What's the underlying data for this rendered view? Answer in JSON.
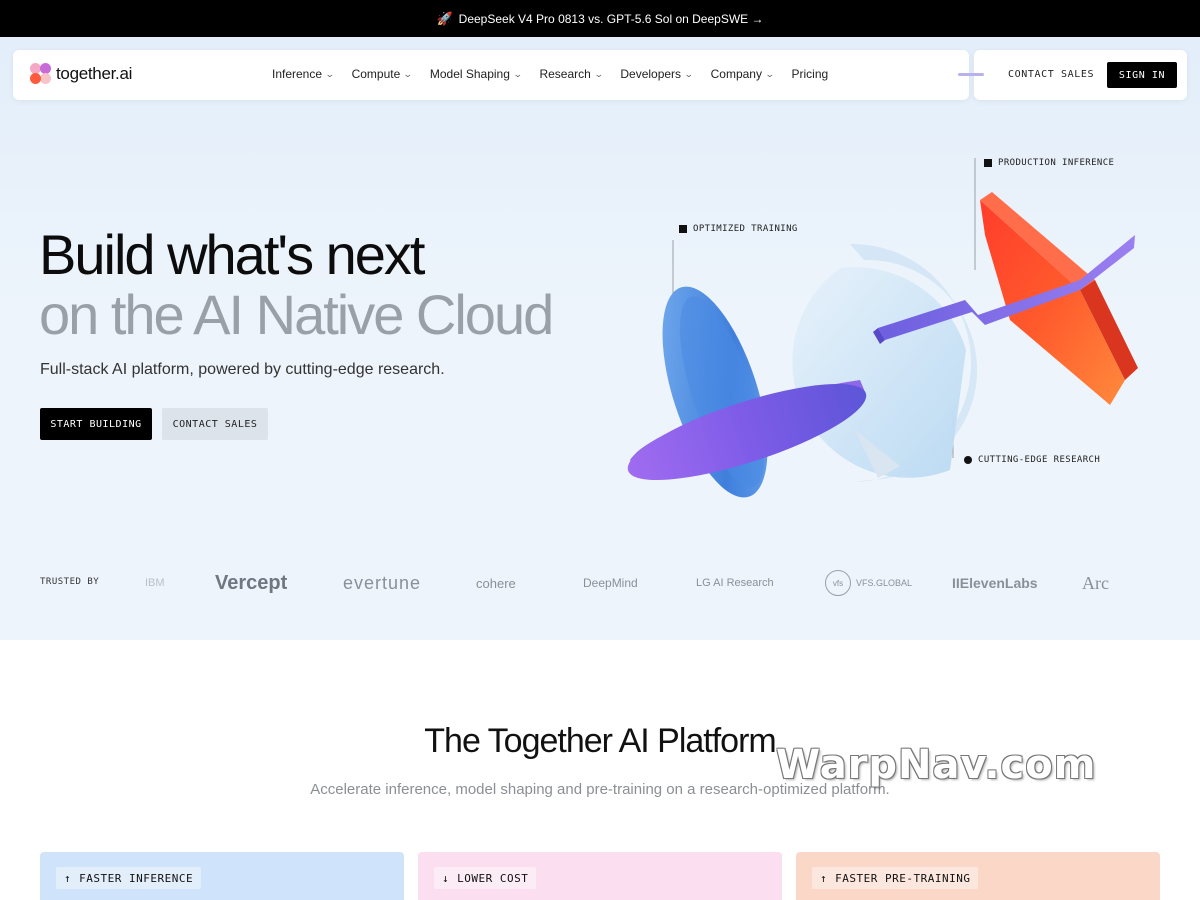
{
  "announcement": {
    "icon": "rocket-icon",
    "text": "DeepSeek V4 Pro 0813 vs. GPT-5.6 Sol on DeepSWE →"
  },
  "header": {
    "logo_text": "together.ai",
    "menu": [
      {
        "label": "Inference",
        "has_dropdown": true
      },
      {
        "label": "Compute",
        "has_dropdown": true
      },
      {
        "label": "Model Shaping",
        "has_dropdown": true
      },
      {
        "label": "Research",
        "has_dropdown": true
      },
      {
        "label": "Developers",
        "has_dropdown": true
      },
      {
        "label": "Company",
        "has_dropdown": true
      },
      {
        "label": "Pricing",
        "has_dropdown": false
      }
    ],
    "contact_sales": "CONTACT SALES",
    "sign_in": "SIGN IN"
  },
  "hero": {
    "title_line1": "Build what's next",
    "title_line2": "on the AI Native Cloud",
    "subtitle": "Full-stack AI platform, powered by cutting-edge research.",
    "cta_primary": "START BUILDING",
    "cta_secondary": "CONTACT SALES",
    "art_labels": {
      "training": "OPTIMIZED TRAINING",
      "inference": "PRODUCTION INFERENCE",
      "research": "CUTTING-EDGE RESEARCH"
    }
  },
  "trusted": {
    "label": "TRUSTED BY",
    "brands": [
      "Vercept",
      "evertune",
      "cohere",
      "DeepMind",
      "LG AI Research",
      "VFS.GLOBAL",
      "IIElevenLabs",
      "Arc"
    ]
  },
  "platform": {
    "title": "The Together AI Platform",
    "subtitle": "Accelerate inference, model shaping and pre-training on a research-optimized platform.",
    "cards": [
      {
        "label": "FASTER INFERENCE",
        "arrow": "↑",
        "color": "#cfe3fb"
      },
      {
        "label": "LOWER COST",
        "arrow": "↓",
        "color": "#fbdff0"
      },
      {
        "label": "FASTER PRE-TRAINING",
        "arrow": "↑",
        "color": "#fbd7c8"
      }
    ]
  },
  "watermark": "WarpNav.com",
  "colors": {
    "accent_black": "#000000",
    "heading_gray": "#9aa0a7",
    "hero_bg": "#e9f1fa"
  }
}
